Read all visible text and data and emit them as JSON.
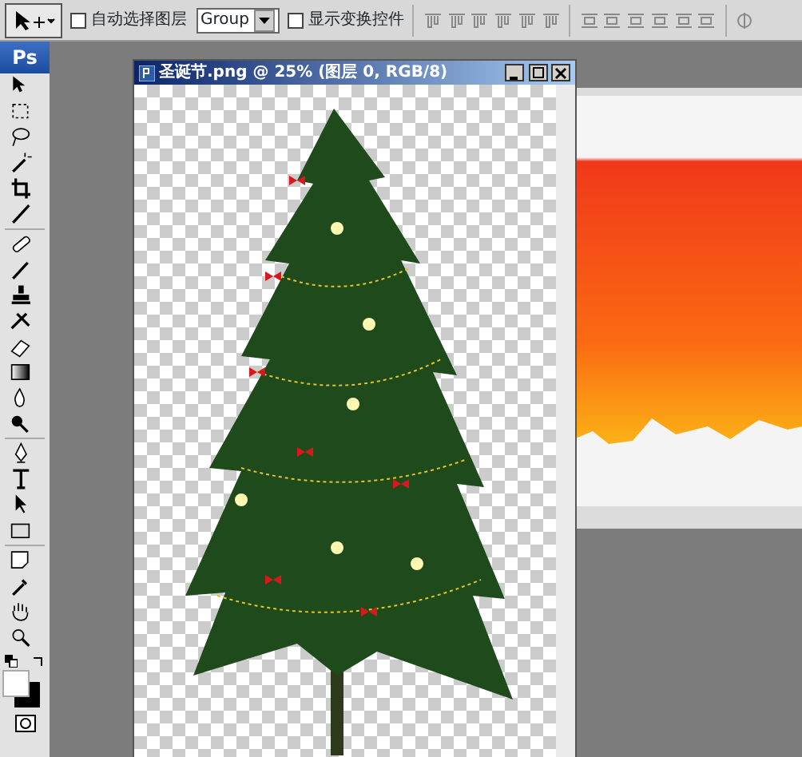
{
  "options_bar": {
    "auto_select": {
      "label": "自动选择图层",
      "checked": false
    },
    "auto_select_target": {
      "value": "Group"
    },
    "show_transform": {
      "label": "显示变换控件",
      "checked": false
    }
  },
  "toolbox": {
    "logo": "Ps"
  },
  "document": {
    "title": "圣诞节.png @ 25% (图层 0, RGB/8)"
  }
}
